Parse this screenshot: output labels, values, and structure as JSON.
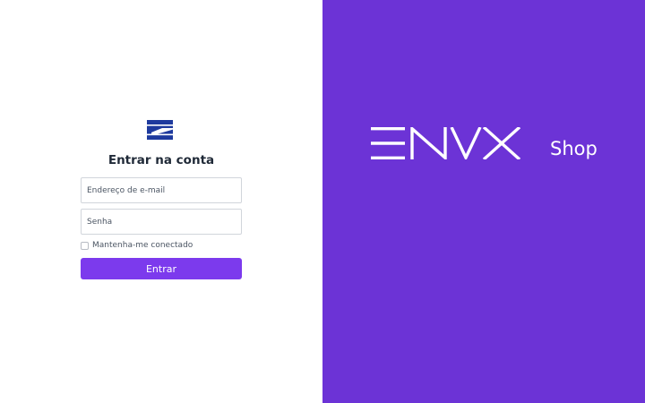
{
  "colors": {
    "brand_purple": "#6c33d6",
    "button_purple": "#7c3aed",
    "logo_blue": "#1e3a9e",
    "title_text": "#1f2937"
  },
  "icons": {
    "app_logo": "stripes-logo-icon",
    "brand_logo": "envx-wordmark"
  },
  "login": {
    "title": "Entrar na conta",
    "email_placeholder": "Endereço de e-mail",
    "email_value": "",
    "password_placeholder": "Senha",
    "password_value": "",
    "remember_label": "Mantenha-me conectado",
    "remember_checked": false,
    "submit_label": "Entrar"
  },
  "brand": {
    "logo_text": "ENVX",
    "word": "Shop"
  }
}
